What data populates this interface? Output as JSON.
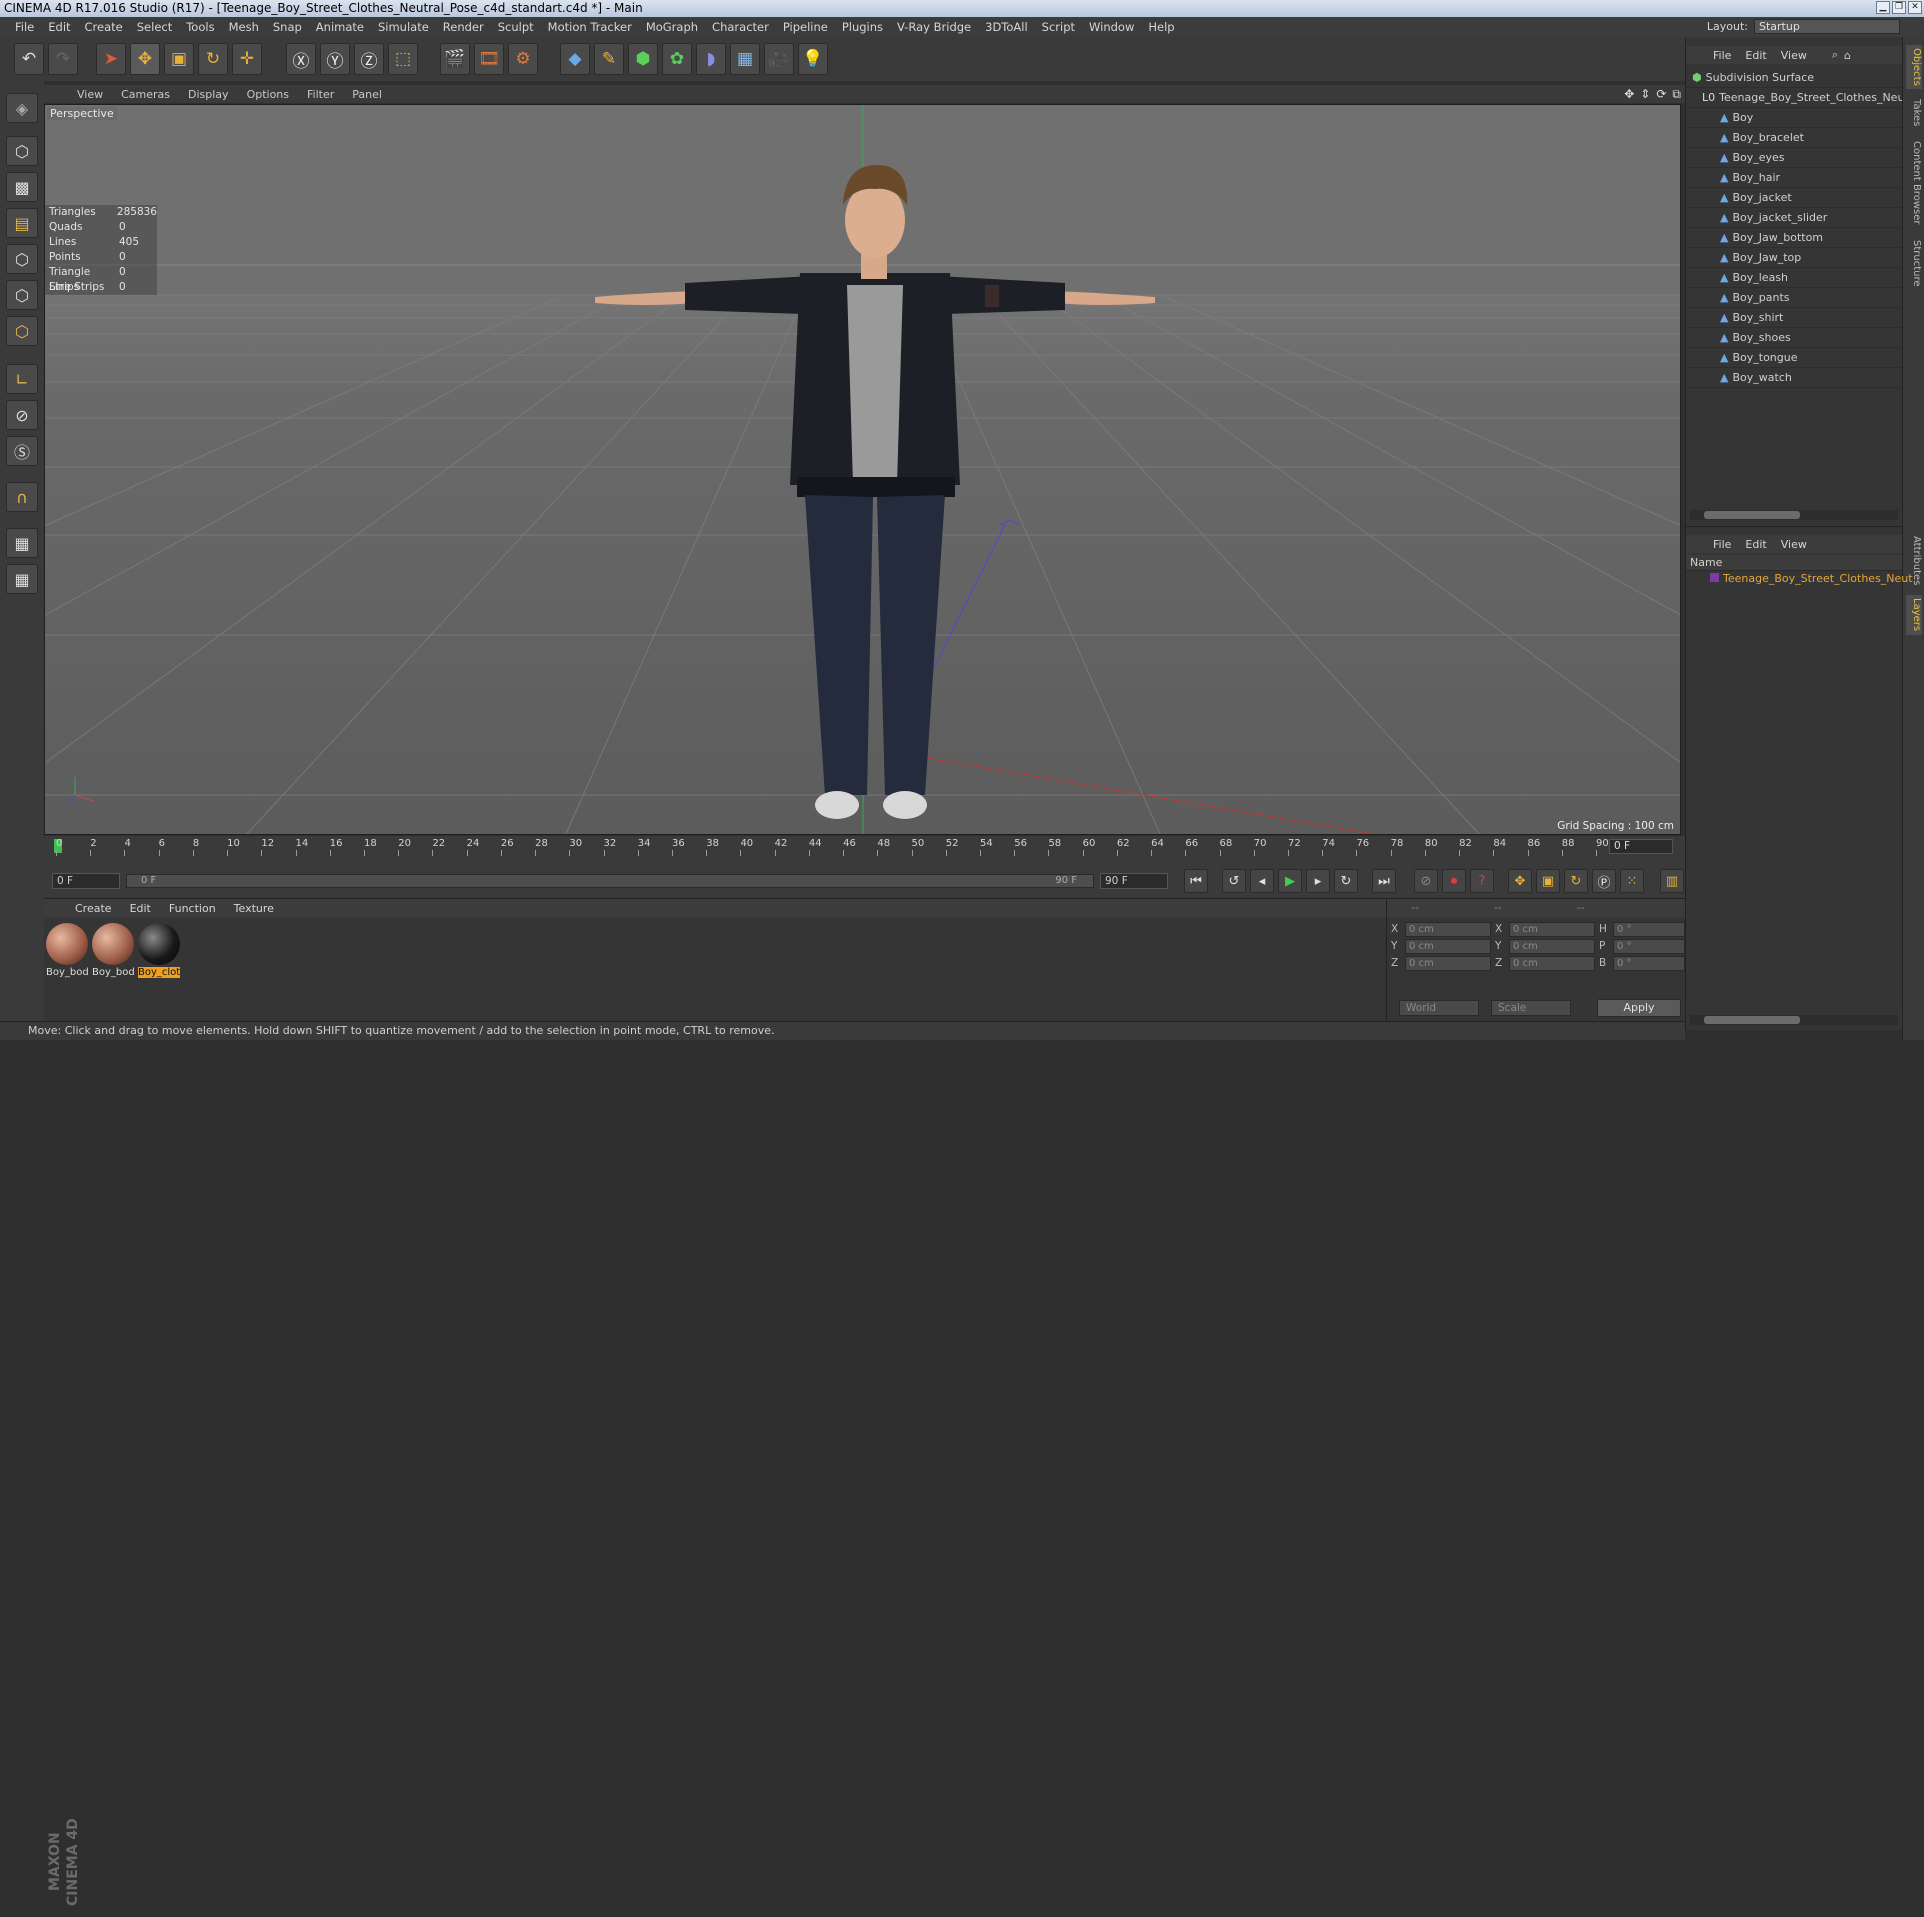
{
  "window": {
    "title": "CINEMA 4D R17.016 Studio (R17) - [Teenage_Boy_Street_Clothes_Neutral_Pose_c4d_standart.c4d *] - Main"
  },
  "menubar": [
    "File",
    "Edit",
    "Create",
    "Select",
    "Tools",
    "Mesh",
    "Snap",
    "Animate",
    "Simulate",
    "Render",
    "Sculpt",
    "Motion Tracker",
    "MoGraph",
    "Character",
    "Pipeline",
    "Plugins",
    "V-Ray Bridge",
    "3DToAll",
    "Script",
    "Window",
    "Help"
  ],
  "layout": {
    "label": "Layout:",
    "value": "Startup"
  },
  "viewport": {
    "menu": [
      "View",
      "Cameras",
      "Display",
      "Options",
      "Filter",
      "Panel"
    ],
    "label": "Perspective",
    "stats": [
      {
        "k": "Triangles",
        "v": "285836"
      },
      {
        "k": "Quads",
        "v": "0"
      },
      {
        "k": "Lines",
        "v": "405"
      },
      {
        "k": "Points",
        "v": "0"
      },
      {
        "k": "Triangle Strips",
        "v": "0"
      },
      {
        "k": "Line Strips",
        "v": "0"
      }
    ],
    "grid_spacing": "Grid Spacing : 100 cm",
    "axis_y": "Y",
    "axis_x": "X"
  },
  "object_manager": {
    "menu": [
      "File",
      "Edit",
      "View"
    ],
    "items": [
      {
        "label": "Subdivision Surface",
        "depth": 0
      },
      {
        "label": "Teenage_Boy_Street_Clothes_Neu",
        "depth": 1
      },
      {
        "label": "Boy",
        "depth": 2
      },
      {
        "label": "Boy_bracelet",
        "depth": 2
      },
      {
        "label": "Boy_eyes",
        "depth": 2
      },
      {
        "label": "Boy_hair",
        "depth": 2
      },
      {
        "label": "Boy_jacket",
        "depth": 2
      },
      {
        "label": "Boy_jacket_slider",
        "depth": 2
      },
      {
        "label": "Boy_Jaw_bottom",
        "depth": 2
      },
      {
        "label": "Boy_Jaw_top",
        "depth": 2
      },
      {
        "label": "Boy_leash",
        "depth": 2
      },
      {
        "label": "Boy_pants",
        "depth": 2
      },
      {
        "label": "Boy_shirt",
        "depth": 2
      },
      {
        "label": "Boy_shoes",
        "depth": 2
      },
      {
        "label": "Boy_tongue",
        "depth": 2
      },
      {
        "label": "Boy_watch",
        "depth": 2
      }
    ]
  },
  "side_tabs": [
    "Objects",
    "Takes",
    "Content Browser",
    "Structure",
    "Attributes",
    "Layers"
  ],
  "layers_manager": {
    "menu": [
      "File",
      "Edit",
      "View"
    ],
    "header": "Name",
    "item": "Teenage_Boy_Street_Clothes_Neut"
  },
  "timeline": {
    "ticks": [
      "0",
      "2",
      "4",
      "6",
      "8",
      "10",
      "12",
      "14",
      "16",
      "18",
      "20",
      "22",
      "24",
      "26",
      "28",
      "30",
      "32",
      "34",
      "36",
      "38",
      "40",
      "42",
      "44",
      "46",
      "48",
      "50",
      "52",
      "54",
      "56",
      "58",
      "60",
      "62",
      "64",
      "66",
      "68",
      "70",
      "72",
      "74",
      "76",
      "78",
      "80",
      "82",
      "84",
      "86",
      "88",
      "90"
    ],
    "current_frame": "0 F",
    "start_field": "0 F",
    "slider_start": "0 F",
    "slider_end": "90 F",
    "end_field": "90 F"
  },
  "material_manager": {
    "menu": [
      "Create",
      "Edit",
      "Function",
      "Texture"
    ],
    "materials": [
      {
        "name": "Boy_bod",
        "selected": false
      },
      {
        "name": "Boy_bod",
        "selected": false
      },
      {
        "name": "Boy_clot",
        "selected": true
      }
    ]
  },
  "coordinates": {
    "headers": [
      "--",
      "--",
      "--"
    ],
    "rows": [
      {
        "a": "X",
        "av": "0 cm",
        "b": "X",
        "bv": "0 cm",
        "c": "H",
        "cv": "0 °"
      },
      {
        "a": "Y",
        "av": "0 cm",
        "b": "Y",
        "bv": "0 cm",
        "c": "P",
        "cv": "0 °"
      },
      {
        "a": "Z",
        "av": "0 cm",
        "b": "Z",
        "bv": "0 cm",
        "c": "B",
        "cv": "0 °"
      }
    ],
    "mode": "World",
    "type": "Scale",
    "apply": "Apply"
  },
  "brand": "MAXON CINEMA 4D",
  "status": "Move: Click and drag to move elements. Hold down SHIFT to quantize movement / add to the selection in point mode, CTRL to remove."
}
